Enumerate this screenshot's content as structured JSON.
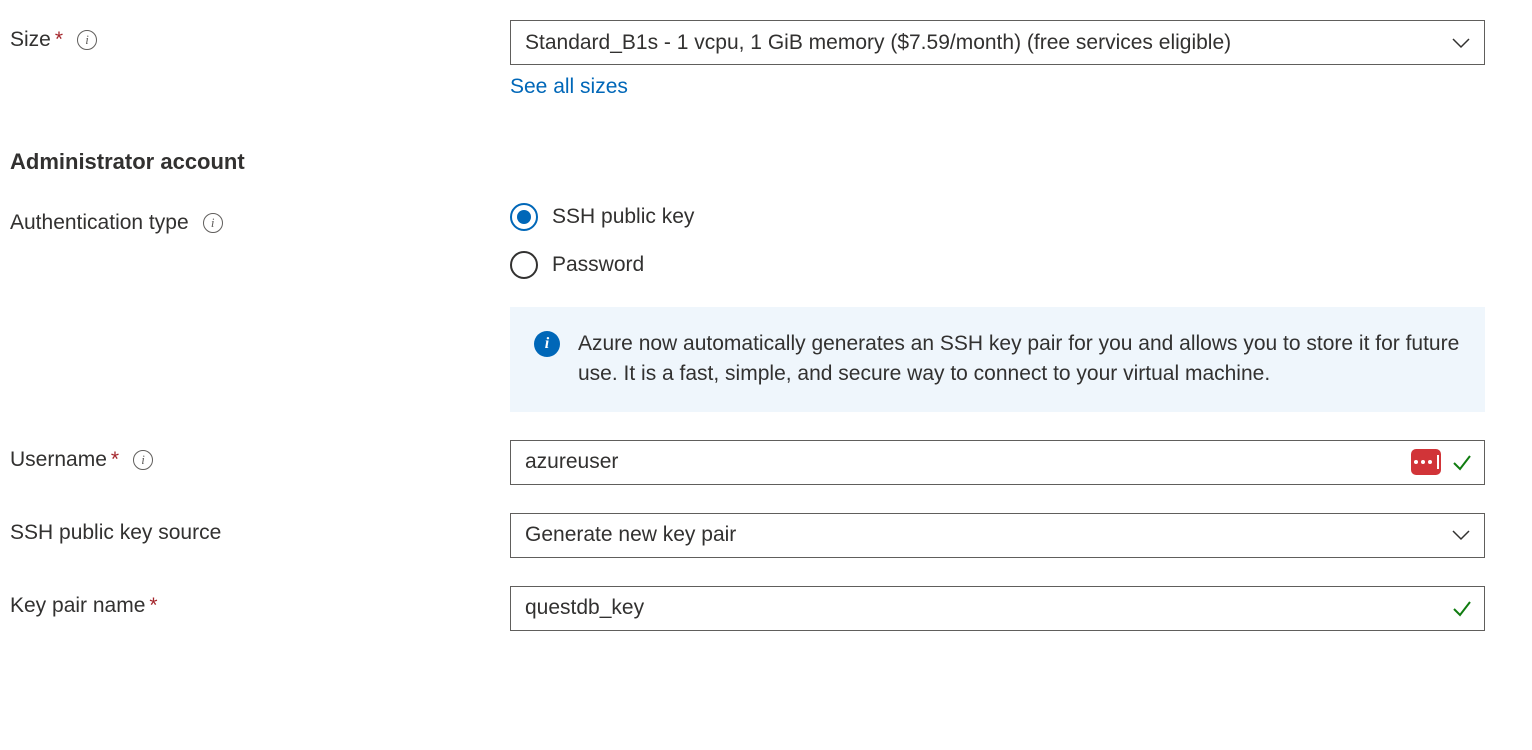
{
  "size": {
    "label": "Size",
    "value": "Standard_B1s - 1 vcpu, 1 GiB memory ($7.59/month)  (free services eligible)",
    "link": "See all sizes"
  },
  "section": {
    "admin_heading": "Administrator account"
  },
  "auth": {
    "label": "Authentication type",
    "options": {
      "ssh": "SSH public key",
      "password": "Password"
    },
    "info_text": "Azure now automatically generates an SSH key pair for you and allows you to store it for future use. It is a fast, simple, and secure way to connect to your virtual machine."
  },
  "username": {
    "label": "Username",
    "value": "azureuser"
  },
  "ssh_source": {
    "label": "SSH public key source",
    "value": "Generate new key pair"
  },
  "keypair": {
    "label": "Key pair name",
    "value": "questdb_key"
  }
}
